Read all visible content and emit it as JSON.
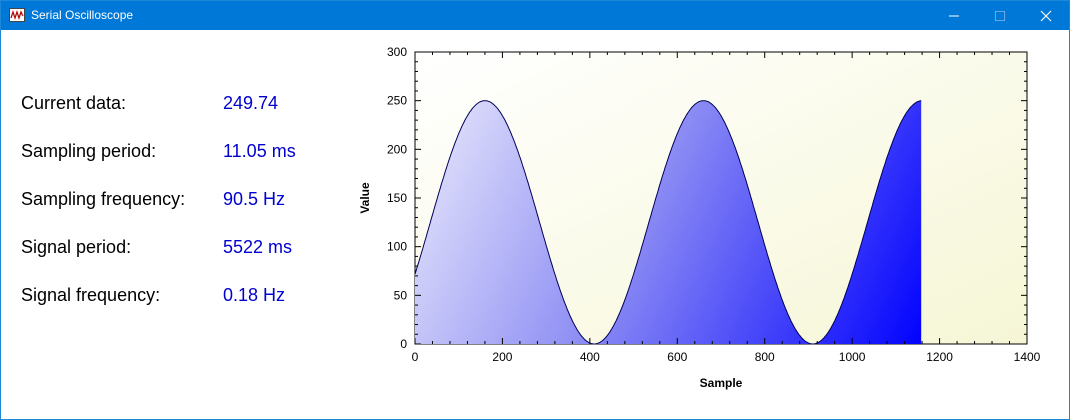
{
  "window": {
    "title": "Serial Oscilloscope",
    "icon": "oscilloscope-app-icon",
    "controls": [
      "minimize-icon",
      "maximize-icon",
      "close-icon"
    ]
  },
  "readouts": [
    {
      "label": "Current data:",
      "value": "249.74"
    },
    {
      "label": "Sampling period:",
      "value": "11.05 ms"
    },
    {
      "label": "Sampling frequency:",
      "value": "90.5 Hz"
    },
    {
      "label": "Signal period:",
      "value": "5522 ms"
    },
    {
      "label": "Signal frequency:",
      "value": "0.18 Hz"
    }
  ],
  "colors": {
    "titlebar": "#0078d7",
    "readout_value": "#0000d0",
    "plot_background": "#fafae0",
    "area_light": "#e8e8fc",
    "area_dark": "#0000ff",
    "line": "#00005a"
  },
  "chart_data": {
    "type": "area",
    "xlabel": "Sample",
    "ylabel": "Value",
    "xlim": [
      0,
      1400
    ],
    "ylim": [
      0,
      300
    ],
    "xticks": [
      "0",
      "200",
      "400",
      "600",
      "800",
      "1000",
      "1200",
      "1400"
    ],
    "yticks": [
      "0",
      "50",
      "100",
      "150",
      "200",
      "250",
      "300"
    ],
    "grid": false,
    "legend": "none",
    "series": [
      {
        "amplitude": 125,
        "offset": 125,
        "period_samples": 500,
        "first_peak_sample": 160,
        "x": [
          0,
          40,
          80,
          120,
          160,
          200,
          240,
          280,
          320,
          360,
          410,
          440,
          480,
          520,
          560,
          600,
          660,
          700,
          740,
          780,
          820,
          860,
          910,
          940,
          980,
          1020,
          1060,
          1100,
          1140,
          1158
        ],
        "y": [
          76,
          130,
          184,
          229,
          250,
          240,
          201,
          145,
          84,
          32,
          0,
          9,
          41,
          91,
          150,
          207,
          250,
          240,
          201,
          145,
          84,
          32,
          0,
          9,
          41,
          91,
          150,
          207,
          243,
          250
        ]
      }
    ]
  }
}
